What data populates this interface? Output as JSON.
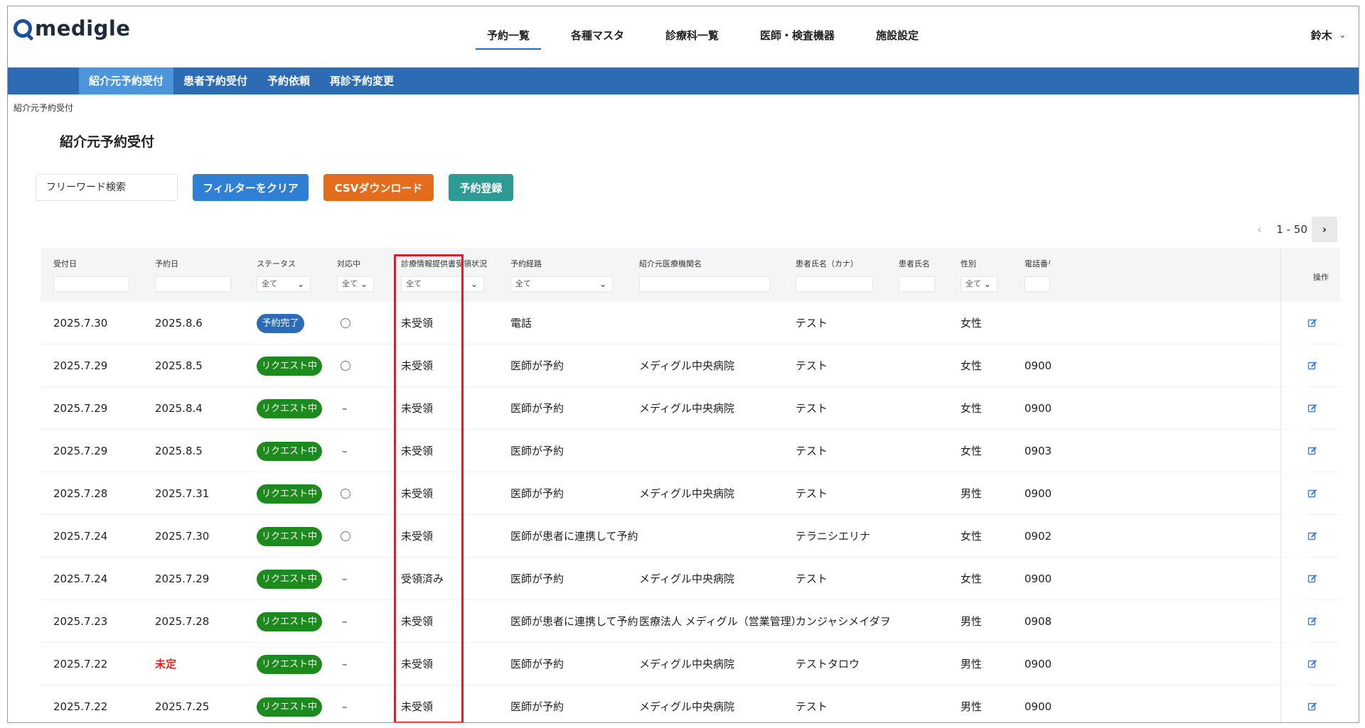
{
  "app": {
    "logo_text": "medigle"
  },
  "mainnav": {
    "items": [
      "予約一覧",
      "各種マスタ",
      "診療科一覧",
      "医師・検査機器",
      "施設設定"
    ],
    "active_index": 0
  },
  "user": {
    "name": "鈴木"
  },
  "subnav": {
    "items": [
      "紹介元予約受付",
      "患者予約受付",
      "予約依頼",
      "再診予約変更"
    ],
    "active_index": 0
  },
  "breadcrumb": "紹介元予約受付",
  "page_title": "紹介元予約受付",
  "toolbar": {
    "search_placeholder": "フリーワード検索",
    "clear_label": "フィルターをクリア",
    "csv_label": "CSVダウンロード",
    "register_label": "予約登録"
  },
  "pager": {
    "label": "1 - 50"
  },
  "table": {
    "headers": {
      "received": "受付日",
      "reserved": "予約日",
      "status": "ステータス",
      "handling": "対応中",
      "info_doc": "診療情報提供書受領状況",
      "route": "予約経路",
      "institution": "紹介元医療機関名",
      "kana": "患者氏名（カナ）",
      "name": "患者氏名",
      "gender": "性別",
      "phone": "電話番号",
      "ops": "操作"
    },
    "filters": {
      "status": "全て",
      "handling": "全て",
      "info_doc": "全て",
      "route": "全て",
      "gender": "全て"
    },
    "rows": [
      {
        "received": "2025.7.30",
        "reserved": "2025.8.6",
        "reserved_red": false,
        "status": "予約完了",
        "status_kind": "done",
        "handling": "circle",
        "info_doc": "未受領",
        "route": "電話",
        "institution": "",
        "kana": "テスト",
        "name": "",
        "gender": "女性",
        "phone": ""
      },
      {
        "received": "2025.7.29",
        "reserved": "2025.8.5",
        "reserved_red": false,
        "status": "リクエスト中",
        "status_kind": "req",
        "handling": "circle",
        "info_doc": "未受領",
        "route": "医師が予約",
        "institution": "メディグル中央病院",
        "kana": "テスト",
        "name": "",
        "gender": "女性",
        "phone": "0900"
      },
      {
        "received": "2025.7.29",
        "reserved": "2025.8.4",
        "reserved_red": false,
        "status": "リクエスト中",
        "status_kind": "req",
        "handling": "dash",
        "info_doc": "未受領",
        "route": "医師が予約",
        "institution": "メディグル中央病院",
        "kana": "テスト",
        "name": "",
        "gender": "女性",
        "phone": "0900"
      },
      {
        "received": "2025.7.29",
        "reserved": "2025.8.5",
        "reserved_red": false,
        "status": "リクエスト中",
        "status_kind": "req",
        "handling": "dash",
        "info_doc": "未受領",
        "route": "医師が予約",
        "institution": "",
        "kana": "テスト",
        "name": "",
        "gender": "女性",
        "phone": "0903"
      },
      {
        "received": "2025.7.28",
        "reserved": "2025.7.31",
        "reserved_red": false,
        "status": "リクエスト中",
        "status_kind": "req",
        "handling": "circle",
        "info_doc": "未受領",
        "route": "医師が予約",
        "institution": "メディグル中央病院",
        "kana": "テスト",
        "name": "",
        "gender": "男性",
        "phone": "0900"
      },
      {
        "received": "2025.7.24",
        "reserved": "2025.7.30",
        "reserved_red": false,
        "status": "リクエスト中",
        "status_kind": "req",
        "handling": "circle",
        "info_doc": "未受領",
        "route": "医師が患者に連携して予約",
        "institution": "",
        "kana": "テラニシエリナ",
        "name": "",
        "gender": "女性",
        "phone": "0902"
      },
      {
        "received": "2025.7.24",
        "reserved": "2025.7.29",
        "reserved_red": false,
        "status": "リクエスト中",
        "status_kind": "req",
        "handling": "dash",
        "info_doc": "受領済み",
        "route": "医師が予約",
        "institution": "メディグル中央病院",
        "kana": "テスト",
        "name": "",
        "gender": "女性",
        "phone": "0900"
      },
      {
        "received": "2025.7.23",
        "reserved": "2025.7.28",
        "reserved_red": false,
        "status": "リクエスト中",
        "status_kind": "req",
        "handling": "dash",
        "info_doc": "未受領",
        "route": "医師が患者に連携して予約",
        "institution": "医療法人 メディグル（営業管理）",
        "kana": "カンジャシメイダヲ",
        "name": "",
        "gender": "男性",
        "phone": "0908"
      },
      {
        "received": "2025.7.22",
        "reserved": "未定",
        "reserved_red": true,
        "status": "リクエスト中",
        "status_kind": "req",
        "handling": "dash",
        "info_doc": "未受領",
        "route": "医師が予約",
        "institution": "メディグル中央病院",
        "kana": "テストタロウ",
        "name": "",
        "gender": "男性",
        "phone": "0900"
      },
      {
        "received": "2025.7.22",
        "reserved": "2025.7.25",
        "reserved_red": false,
        "status": "リクエスト中",
        "status_kind": "req",
        "handling": "dash",
        "info_doc": "未受領",
        "route": "医師が予約",
        "institution": "メディグル中央病院",
        "kana": "テスト",
        "name": "",
        "gender": "男性",
        "phone": "0900"
      }
    ],
    "dash_symbol": "–"
  },
  "colors": {
    "primary": "#2d6cb4",
    "clear_btn": "#2f80d4",
    "csv_btn": "#e36c1d",
    "register_btn": "#2e9a94",
    "status_done": "#2d6cb4",
    "status_request": "#1d8a1d",
    "highlight": "#e31b23"
  },
  "icons": [
    "logo-search-icon",
    "chevron-down-icon",
    "chevron-left-icon",
    "chevron-right-icon",
    "edit-icon"
  ]
}
